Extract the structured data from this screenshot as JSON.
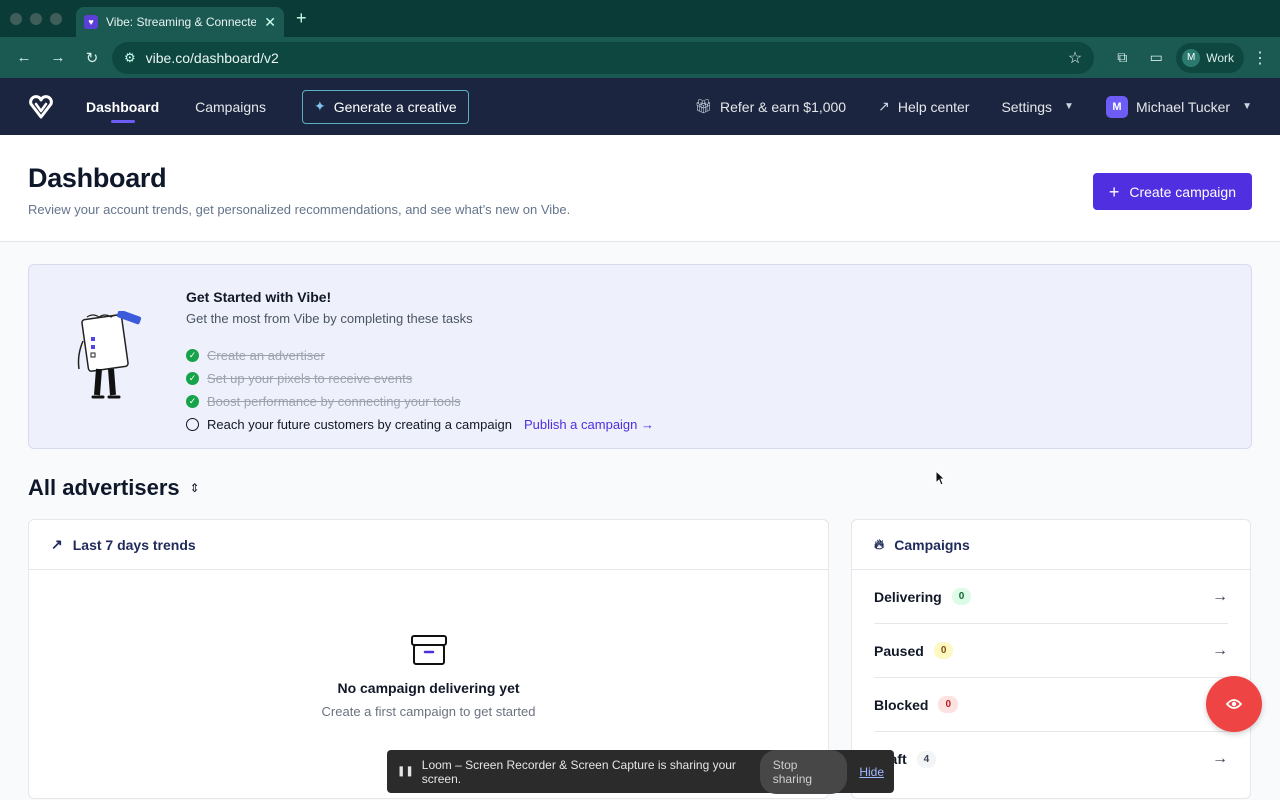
{
  "browser": {
    "tab_title": "Vibe: Streaming & Connected",
    "new_tab": "+",
    "url": "vibe.co/dashboard/v2",
    "profile_initial": "M",
    "profile_label": "Work"
  },
  "nav": {
    "items": [
      {
        "label": "Dashboard",
        "active": true
      },
      {
        "label": "Campaigns",
        "active": false
      }
    ],
    "generate_label": "Generate a creative",
    "refer_label": "Refer & earn $1,000",
    "help_label": "Help center",
    "settings_label": "Settings",
    "user_name": "Michael Tucker",
    "user_initial": "M"
  },
  "header": {
    "title": "Dashboard",
    "subtitle": "Review your account trends, get personalized recommendations, and see what’s new on Vibe.",
    "create_label": "Create campaign"
  },
  "get_started": {
    "title": "Get Started with Vibe!",
    "subtitle": "Get the most from Vibe by completing these tasks",
    "tasks": [
      {
        "label": "Create an advertiser",
        "done": true
      },
      {
        "label": "Set up your pixels to receive events",
        "done": true
      },
      {
        "label": "Boost performance by connecting your tools",
        "done": true
      },
      {
        "label": "Reach your future customers by creating a campaign",
        "done": false,
        "link": "Publish a campaign →"
      }
    ]
  },
  "advertisers_title": "All advertisers",
  "trends": {
    "title": "Last 7 days trends",
    "empty_title": "No campaign delivering yet",
    "empty_sub": "Create a first campaign to get started"
  },
  "campaigns": {
    "title": "Campaigns",
    "rows": [
      {
        "label": "Delivering",
        "count": "0",
        "tone": "green"
      },
      {
        "label": "Paused",
        "count": "0",
        "tone": "yellow"
      },
      {
        "label": "Blocked",
        "count": "0",
        "tone": "red"
      },
      {
        "label": "Draft",
        "count": "4",
        "tone": "gray"
      }
    ]
  },
  "loom": {
    "message": "Loom – Screen Recorder & Screen Capture is sharing your screen.",
    "stop_label": "Stop sharing",
    "hide_label": "Hide"
  },
  "colors": {
    "brand": "#4f2fe0",
    "nav_bg": "#1c2540",
    "browser_bg": "#1b5a52"
  }
}
